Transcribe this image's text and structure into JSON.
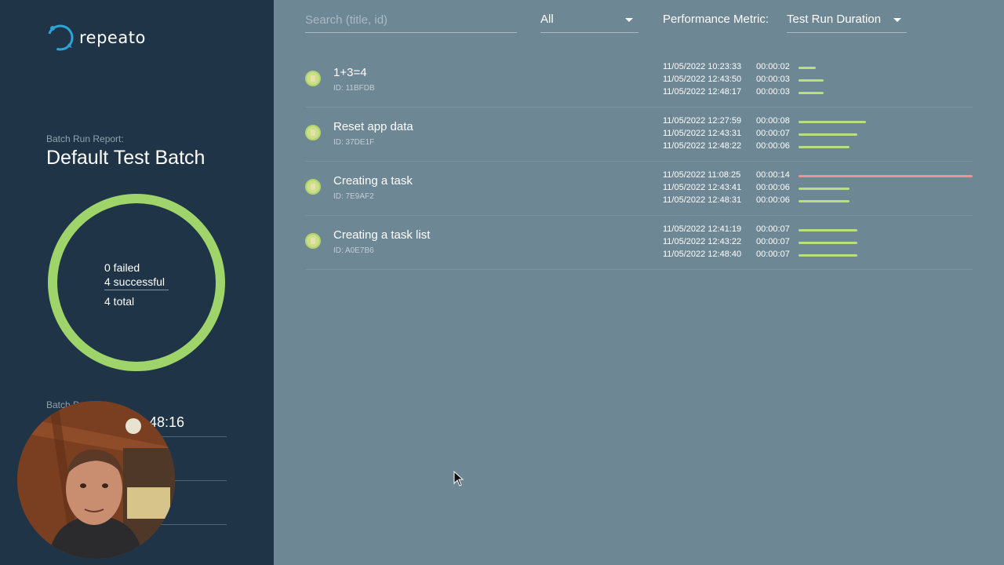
{
  "app": {
    "logo_text": "repeato"
  },
  "sidebar": {
    "report_label": "Batch Run Report:",
    "batch_title": "Default Test Batch",
    "summary": {
      "failed": "0 failed",
      "successful": "4 successful",
      "total": "4 total",
      "success_fraction": 1.0
    },
    "duration_label": "Batch D",
    "duration_value_partial": "48:16"
  },
  "toolbar": {
    "search_placeholder": "Search (title, id)",
    "filter_value": "All",
    "metric_label": "Performance Metric:",
    "metric_value": "Test Run Duration"
  },
  "colors": {
    "ok_bar": "#b9e07c",
    "slow_bar": "#f0928f",
    "sidebar_bg": "#1f3547",
    "main_bg": "#6e8795",
    "donut": "#9fd46a"
  },
  "tests": [
    {
      "name": "1+3=4",
      "id": "ID: 11BFDB",
      "runs": [
        {
          "date": "11/05/2022 10:23:33",
          "duration": "00:00:02",
          "seconds": 2,
          "status": "ok"
        },
        {
          "date": "11/05/2022 12:43:50",
          "duration": "00:00:03",
          "seconds": 3,
          "status": "ok"
        },
        {
          "date": "11/05/2022 12:48:17",
          "duration": "00:00:03",
          "seconds": 3,
          "status": "ok"
        }
      ]
    },
    {
      "name": "Reset app data",
      "id": "ID: 37DE1F",
      "runs": [
        {
          "date": "11/05/2022 12:27:59",
          "duration": "00:00:08",
          "seconds": 8,
          "status": "ok"
        },
        {
          "date": "11/05/2022 12:43:31",
          "duration": "00:00:07",
          "seconds": 7,
          "status": "ok"
        },
        {
          "date": "11/05/2022 12:48:22",
          "duration": "00:00:06",
          "seconds": 6,
          "status": "ok"
        }
      ]
    },
    {
      "name": "Creating a task",
      "id": "ID: 7E9AF2",
      "runs": [
        {
          "date": "11/05/2022 11:08:25",
          "duration": "00:00:14",
          "seconds": 14,
          "status": "slow"
        },
        {
          "date": "11/05/2022 12:43:41",
          "duration": "00:00:06",
          "seconds": 6,
          "status": "ok"
        },
        {
          "date": "11/05/2022 12:48:31",
          "duration": "00:00:06",
          "seconds": 6,
          "status": "ok"
        }
      ]
    },
    {
      "name": "Creating a task list",
      "id": "ID: A0E7B6",
      "runs": [
        {
          "date": "11/05/2022 12:41:19",
          "duration": "00:00:07",
          "seconds": 7,
          "status": "ok"
        },
        {
          "date": "11/05/2022 12:43:22",
          "duration": "00:00:07",
          "seconds": 7,
          "status": "ok"
        },
        {
          "date": "11/05/2022 12:48:40",
          "duration": "00:00:07",
          "seconds": 7,
          "status": "ok"
        }
      ]
    }
  ]
}
